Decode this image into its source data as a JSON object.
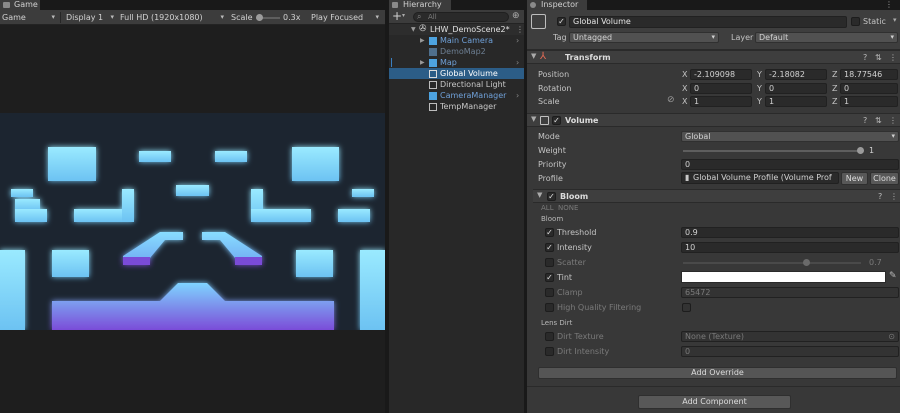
{
  "game": {
    "tab_label": "Game",
    "toolbar": {
      "view_select": "Game",
      "display": "Display 1",
      "resolution": "Full HD (1920x1080)",
      "scale_label": "Scale",
      "scale_value": "0.3x",
      "play_mode": "Play Focused"
    }
  },
  "hierarchy": {
    "tab_label": "Hierarchy",
    "add_label": "+",
    "search_placeholder": "All",
    "scene_name": "LHW_DemoScene2*",
    "items": [
      {
        "label": "Main Camera"
      },
      {
        "label": "DemoMap2"
      },
      {
        "label": "Map"
      },
      {
        "label": "Global Volume"
      },
      {
        "label": "Directional Light"
      },
      {
        "label": "CameraManager"
      },
      {
        "label": "TempManager"
      }
    ]
  },
  "inspector": {
    "tab_label": "Inspector",
    "object_name": "Global Volume",
    "static_label": "Static",
    "tag_label": "Tag",
    "tag_value": "Untagged",
    "layer_label": "Layer",
    "layer_value": "Default",
    "transform": {
      "title": "Transform",
      "position_label": "Position",
      "rotation_label": "Rotation",
      "scale_label": "Scale",
      "px": "-2.109098",
      "py": "-2.18082",
      "pz": "18.77546",
      "rx": "0",
      "ry": "0",
      "rz": "0",
      "sx": "1",
      "sy": "1",
      "sz": "1",
      "x": "X",
      "y": "Y",
      "z": "Z"
    },
    "volume": {
      "title": "Volume",
      "mode_label": "Mode",
      "mode_value": "Global",
      "weight_label": "Weight",
      "weight_value": "1",
      "priority_label": "Priority",
      "priority_value": "0",
      "profile_label": "Profile",
      "profile_value": "Global Volume Profile (Volume Prof",
      "new_button": "New",
      "clone_button": "Clone"
    },
    "bloom": {
      "title": "Bloom",
      "all_label": "ALL",
      "none_label": "NONE",
      "section_bloom": "Bloom",
      "threshold_label": "Threshold",
      "threshold_value": "0.9",
      "intensity_label": "Intensity",
      "intensity_value": "10",
      "scatter_label": "Scatter",
      "scatter_value": "0.7",
      "tint_label": "Tint",
      "clamp_label": "Clamp",
      "clamp_value": "65472",
      "hq_label": "High Quality Filtering",
      "section_lens": "Lens Dirt",
      "dirt_texture_label": "Dirt Texture",
      "dirt_texture_value": "None (Texture)",
      "dirt_intensity_label": "Dirt Intensity",
      "dirt_intensity_value": "0"
    },
    "add_override": "Add Override",
    "add_component": "Add Component"
  },
  "colors": {
    "selection": "#2c5d87",
    "blue_text": "#6fa0d8",
    "cyan_top": "#8fe6ff",
    "purple_bottom": "#7a4cd8"
  }
}
